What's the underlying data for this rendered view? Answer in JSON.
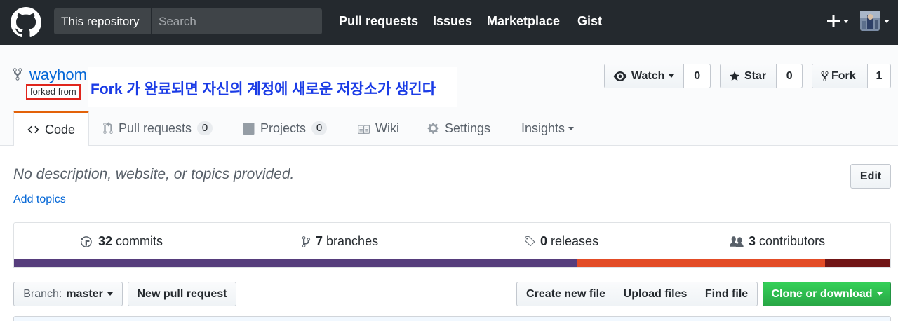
{
  "header": {
    "search_scope": "This repository",
    "search_placeholder": "Search",
    "nav": [
      "Pull requests",
      "Issues",
      "Marketplace",
      "Gist"
    ]
  },
  "repo": {
    "owner": "wayhom",
    "forked_from": "forked from",
    "annotation": "Fork 가 완료되면 자신의 계정에 새로운 저장소가 생긴다",
    "watch_label": "Watch",
    "watch_count": "0",
    "star_label": "Star",
    "star_count": "0",
    "fork_label": "Fork",
    "fork_count": "1"
  },
  "tabs": {
    "code": "Code",
    "pull_requests": "Pull requests",
    "pull_requests_count": "0",
    "projects": "Projects",
    "projects_count": "0",
    "wiki": "Wiki",
    "settings": "Settings",
    "insights": "Insights"
  },
  "about": {
    "description": "No description, website, or topics provided.",
    "add_topics": "Add topics",
    "edit_label": "Edit"
  },
  "summary": {
    "commits_count": "32",
    "commits_label": "commits",
    "branches_count": "7",
    "branches_label": "branches",
    "releases_count": "0",
    "releases_label": "releases",
    "contributors_count": "3",
    "contributors_label": "contributors",
    "language_bar": [
      {
        "color": "#563d7c",
        "fraction": 0.642
      },
      {
        "color": "#e34c26",
        "fraction": 0.282
      },
      {
        "color": "#701516",
        "fraction": 0.076
      }
    ]
  },
  "file_nav": {
    "branch_prefix": "Branch:",
    "branch_name": "master",
    "new_pull_request": "New pull request",
    "create_new_file": "Create new file",
    "upload_files": "Upload files",
    "find_file": "Find file",
    "clone_or_download": "Clone or download"
  },
  "colors": {
    "header_bg": "#24292e",
    "link": "#0366d6",
    "annotation": "#1a3be6",
    "highlight_box": "#e0251c",
    "tab_accent": "#e36209",
    "clone_green": "#28a745"
  }
}
